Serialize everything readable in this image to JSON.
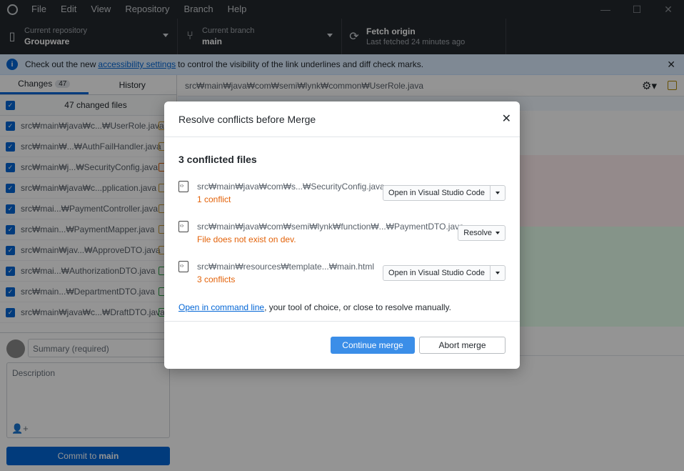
{
  "menu": [
    "File",
    "Edit",
    "View",
    "Repository",
    "Branch",
    "Help"
  ],
  "window_controls": {
    "minimize": "—",
    "maximize": "☐",
    "close": "✕"
  },
  "toolbar": {
    "repo_label": "Current repository",
    "repo_value": "Groupware",
    "branch_label": "Current branch",
    "branch_value": "main",
    "fetch_label": "Fetch origin",
    "fetch_value": "Last fetched 24 minutes ago"
  },
  "banner": {
    "prefix": "Check out the new ",
    "link": "accessibility settings",
    "suffix": " to control the visibility of the link underlines and diff check marks."
  },
  "sidebar": {
    "tab_changes": "Changes",
    "tab_changes_count": "47",
    "tab_history": "History",
    "changed_files": "47 changed files",
    "files": [
      "src₩main₩java₩c...₩UserRole.java",
      "src₩main₩...₩AuthFailHandler.java",
      "src₩main₩j...₩SecurityConfig.java",
      "src₩main₩java₩c...pplication.java",
      "src₩mai...₩PaymentController.java",
      "src₩main...₩PaymentMapper.java",
      "src₩main₩jav...₩ApproveDTO.java",
      "src₩mai...₩AuthorizationDTO.java",
      "src₩main...₩DepartmentDTO.java",
      "src₩main₩java₩c...₩DraftDTO.java"
    ],
    "summary_placeholder": "Summary (required)",
    "description_placeholder": "Description",
    "commit_prefix": "Commit to ",
    "commit_branch": "main"
  },
  "main": {
    "file_path": "src₩main₩java₩com₩semi₩lynk₩common₩UserRole.java"
  },
  "modal": {
    "title": "Resolve conflicts before Merge",
    "conflict_heading": "3 conflicted files",
    "conflicts": [
      {
        "path": "src₩main₩java₩com₩s...₩SecurityConfig.java",
        "status": "1 conflict",
        "action": "Open in Visual Studio Code"
      },
      {
        "path": "src₩main₩java₩com₩semi₩lynk₩function₩...₩PaymentDTO.java",
        "status": "File does not exist on dev.",
        "action": "Resolve"
      },
      {
        "path": "src₩main₩resources₩template...₩main.html",
        "status": "3 conflicts",
        "action": "Open in Visual Studio Code"
      }
    ],
    "cmd_link": "Open in command line",
    "cmd_rest": ", your tool of choice, or close to resolve manually.",
    "continue_label": "Continue merge",
    "abort_label": "Abort merge"
  },
  "colors": {
    "accent": "#0366d6",
    "dark": "#24292e",
    "conflict": "#e36209",
    "diff_removed": "#ffeef0",
    "diff_added": "#e6ffed"
  }
}
